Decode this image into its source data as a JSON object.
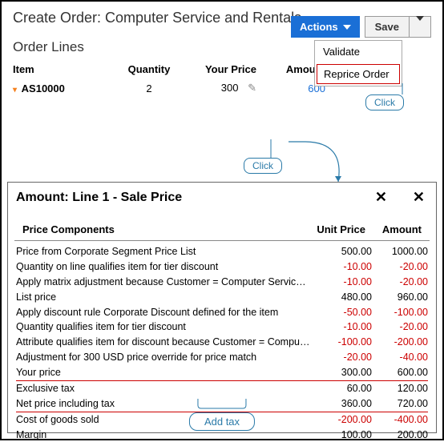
{
  "header": {
    "title": "Create Order: Computer Service and Rentals",
    "actions_label": "Actions",
    "save_label": "Save"
  },
  "actions_menu": {
    "items": [
      {
        "label": "Validate",
        "highlighted": false
      },
      {
        "label": "Reprice Order",
        "highlighted": true
      }
    ]
  },
  "callouts": {
    "click": "Click",
    "add_tax": "Add tax"
  },
  "order_lines": {
    "title": "Order Lines",
    "columns": {
      "item": "Item",
      "qty": "Quantity",
      "price": "Your Price",
      "amount": "Amount"
    },
    "rows": [
      {
        "item": "AS10000",
        "qty": "2",
        "price": "300",
        "amount": "600"
      }
    ]
  },
  "panel": {
    "title": "Amount: Line 1 - Sale Price",
    "columns": {
      "components": "Price Components",
      "unit": "Unit Price",
      "amount": "Amount"
    },
    "rows": [
      {
        "label": "Price from Corporate  Segment Price List",
        "unit": "500.00",
        "amount": "1000.00",
        "neg": false
      },
      {
        "label": "Quantity on line qualifies item for tier discount",
        "unit": "-10.00",
        "amount": "-20.00",
        "neg": true
      },
      {
        "label": "Apply matrix adjustment because Customer = Computer Service a. . .",
        "unit": "-10.00",
        "amount": "-20.00",
        "neg": true
      },
      {
        "label": "List price",
        "unit": "480.00",
        "amount": "960.00",
        "neg": false
      },
      {
        "label": "Apply discount rule Corporate Discount defined for the item",
        "unit": "-50.00",
        "amount": "-100.00",
        "neg": true
      },
      {
        "label": "Quantity qualifies item for tier discount",
        "unit": "-10.00",
        "amount": "-20.00",
        "neg": true
      },
      {
        "label": "Attribute qualifies item for discount because Customer = Computer. . .",
        "unit": "-100.00",
        "amount": "-200.00",
        "neg": true
      },
      {
        "label": "Adjustment for 300 USD price override  for price match",
        "unit": "-20.00",
        "amount": "-40.00",
        "neg": true
      },
      {
        "label": "Your price",
        "unit": "300.00",
        "amount": "600.00",
        "neg": false
      },
      {
        "label": "Exclusive tax",
        "unit": "60.00",
        "amount": "120.00",
        "neg": false,
        "tax_top": true
      },
      {
        "label": "Net price including tax",
        "unit": "360.00",
        "amount": "720.00",
        "neg": false,
        "tax_bot": true
      },
      {
        "label": "Cost of goods sold",
        "unit": "-200.00",
        "amount": "-400.00",
        "neg": true
      },
      {
        "label": "Margin",
        "unit": "100.00",
        "amount": "200.00",
        "neg": false
      }
    ]
  }
}
